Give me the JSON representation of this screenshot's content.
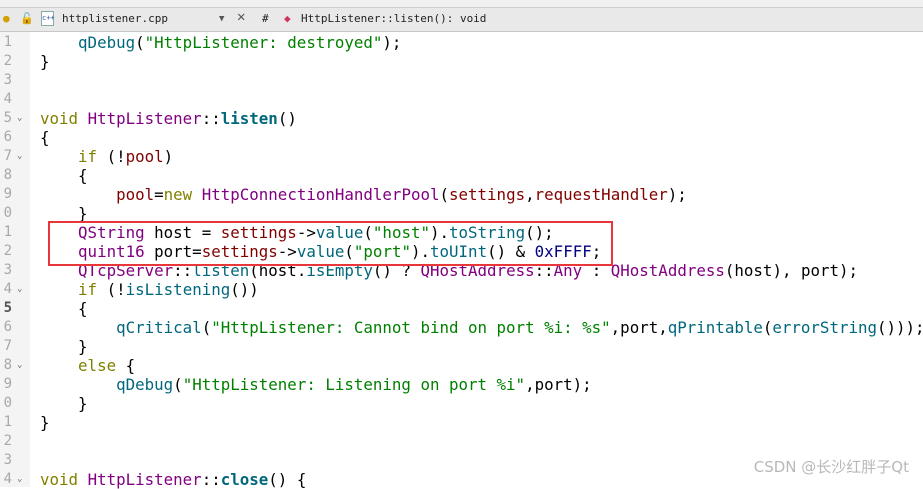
{
  "toolbar": {
    "file_name": "httplistener.cpp",
    "hash": "#",
    "symbol": "HttpListener::listen(): void"
  },
  "lines": [
    {
      "num": "1",
      "tokens": [
        [
          "",
          "    "
        ],
        [
          "fn",
          "qDebug"
        ],
        [
          "",
          "("
        ],
        [
          "st",
          "\"HttpListener: destroyed\""
        ],
        [
          "",
          ");"
        ]
      ]
    },
    {
      "num": "2",
      "tokens": [
        [
          "",
          "}"
        ]
      ]
    },
    {
      "num": "3",
      "tokens": []
    },
    {
      "num": "4",
      "tokens": []
    },
    {
      "num": "5",
      "fold": true,
      "tokens": [
        [
          "kw",
          "void"
        ],
        [
          "",
          " "
        ],
        [
          "ty",
          "HttpListener"
        ],
        [
          "",
          "::"
        ],
        [
          "fd",
          "listen"
        ],
        [
          "",
          "()"
        ]
      ]
    },
    {
      "num": "6",
      "tokens": [
        [
          "",
          "{"
        ]
      ]
    },
    {
      "num": "7",
      "fold": true,
      "tokens": [
        [
          "",
          "    "
        ],
        [
          "kw",
          "if"
        ],
        [
          "",
          " (!"
        ],
        [
          "mb",
          "pool"
        ],
        [
          "",
          ")"
        ]
      ]
    },
    {
      "num": "8",
      "tokens": [
        [
          "",
          "    {"
        ]
      ]
    },
    {
      "num": "9",
      "tokens": [
        [
          "",
          "        "
        ],
        [
          "mb",
          "pool"
        ],
        [
          "",
          "="
        ],
        [
          "kw",
          "new"
        ],
        [
          "",
          " "
        ],
        [
          "ty",
          "HttpConnectionHandlerPool"
        ],
        [
          "",
          "("
        ],
        [
          "mb",
          "settings"
        ],
        [
          "",
          ","
        ],
        [
          "mb",
          "requestHandler"
        ],
        [
          "",
          ");"
        ]
      ]
    },
    {
      "num": "0",
      "tokens": [
        [
          "",
          "    }"
        ]
      ]
    },
    {
      "num": "1",
      "tokens": [
        [
          "",
          "    "
        ],
        [
          "ty",
          "QString"
        ],
        [
          "",
          " host = "
        ],
        [
          "mb",
          "settings"
        ],
        [
          "",
          "->"
        ],
        [
          "fn",
          "value"
        ],
        [
          "",
          "("
        ],
        [
          "st",
          "\"host\""
        ],
        [
          "",
          ")."
        ],
        [
          "fn",
          "toString"
        ],
        [
          "",
          "();"
        ]
      ]
    },
    {
      "num": "2",
      "tokens": [
        [
          "",
          "    "
        ],
        [
          "ty",
          "quint16"
        ],
        [
          "",
          " port="
        ],
        [
          "mb",
          "settings"
        ],
        [
          "",
          "->"
        ],
        [
          "fn",
          "value"
        ],
        [
          "",
          "("
        ],
        [
          "st",
          "\"port\""
        ],
        [
          "",
          ")."
        ],
        [
          "fn",
          "toUInt"
        ],
        [
          "",
          "() & "
        ],
        [
          "nm",
          "0xFFFF"
        ],
        [
          "",
          ";"
        ]
      ]
    },
    {
      "num": "3",
      "tokens": [
        [
          "",
          "    "
        ],
        [
          "ty",
          "QTcpServer"
        ],
        [
          "",
          "::"
        ],
        [
          "fn",
          "listen"
        ],
        [
          "",
          "(host."
        ],
        [
          "fn",
          "isEmpty"
        ],
        [
          "",
          "() ? "
        ],
        [
          "ty",
          "QHostAddress"
        ],
        [
          "",
          "::"
        ],
        [
          "ty",
          "Any"
        ],
        [
          "",
          " : "
        ],
        [
          "ty",
          "QHostAddress"
        ],
        [
          "",
          "(host), port);"
        ]
      ]
    },
    {
      "num": "4",
      "fold": true,
      "tokens": [
        [
          "",
          "    "
        ],
        [
          "kw",
          "if"
        ],
        [
          "",
          " (!"
        ],
        [
          "fn",
          "isListening"
        ],
        [
          "",
          "())"
        ]
      ]
    },
    {
      "num": "5",
      "current": true,
      "tokens": [
        [
          "",
          "    {"
        ]
      ]
    },
    {
      "num": "6",
      "tokens": [
        [
          "",
          "        "
        ],
        [
          "fn",
          "qCritical"
        ],
        [
          "",
          "("
        ],
        [
          "st",
          "\"HttpListener: Cannot bind on port %i: %s\""
        ],
        [
          "",
          ",port,"
        ],
        [
          "fn",
          "qPrintable"
        ],
        [
          "",
          "("
        ],
        [
          "fn",
          "errorString"
        ],
        [
          "",
          "()));"
        ]
      ]
    },
    {
      "num": "7",
      "tokens": [
        [
          "",
          "    }"
        ]
      ]
    },
    {
      "num": "8",
      "fold": true,
      "tokens": [
        [
          "",
          "    "
        ],
        [
          "kw",
          "else"
        ],
        [
          "",
          " {"
        ]
      ]
    },
    {
      "num": "9",
      "tokens": [
        [
          "",
          "        "
        ],
        [
          "fn",
          "qDebug"
        ],
        [
          "",
          "("
        ],
        [
          "st",
          "\"HttpListener: Listening on port %i\""
        ],
        [
          "",
          ",port);"
        ]
      ]
    },
    {
      "num": "0",
      "tokens": [
        [
          "",
          "    }"
        ]
      ]
    },
    {
      "num": "1",
      "tokens": [
        [
          "",
          "}"
        ]
      ]
    },
    {
      "num": "2",
      "tokens": []
    },
    {
      "num": "3",
      "tokens": []
    },
    {
      "num": "4",
      "fold": true,
      "tokens": [
        [
          "kw",
          "void"
        ],
        [
          "",
          " "
        ],
        [
          "ty",
          "HttpListener"
        ],
        [
          "",
          "::"
        ],
        [
          "fd",
          "close"
        ],
        [
          "",
          "() {"
        ]
      ]
    }
  ],
  "watermark": "CSDN @长沙红胖子Qt",
  "colors": {
    "highlight_box": "#e8363a"
  }
}
